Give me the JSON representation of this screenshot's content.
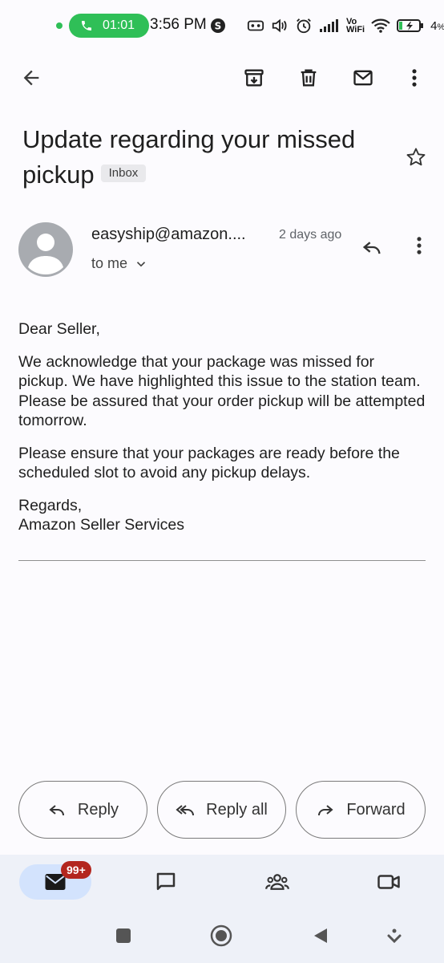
{
  "status_bar": {
    "call_timer": "01:01",
    "time": "3:56 PM",
    "network_top": "Vo",
    "network_bottom": "WiFi",
    "battery_percent": "4",
    "battery_percent_sign": "%"
  },
  "appbar": {
    "icons": [
      "back-arrow-icon",
      "archive-icon",
      "delete-icon",
      "mark-unread-icon",
      "more-vert-icon"
    ]
  },
  "email": {
    "subject": "Update regarding your missed pickup",
    "label_chip": "Inbox",
    "sender": "easyship@amazon....",
    "date": "2 days ago",
    "recipient": "to me",
    "body": {
      "greeting": "Dear Seller,",
      "paragraph1": "We acknowledge that your package was missed for pickup. We have highlighted this issue to the station team. Please be assured that your order pickup will be attempted tomorrow.",
      "paragraph2": "Please ensure that your packages are ready before the scheduled slot to avoid any pickup delays.",
      "signoff": "Regards,",
      "signature": "Amazon Seller Services"
    }
  },
  "actions": {
    "reply": "Reply",
    "reply_all": "Reply all",
    "forward": "Forward"
  },
  "bottom_nav": {
    "mail_badge": "99+",
    "items": [
      "mail-icon",
      "chat-icon",
      "spaces-icon",
      "meet-icon"
    ]
  },
  "colors": {
    "call_green": "#2fbf57",
    "active_nav": "#d3e3fd",
    "badge_red": "#b3261e",
    "nav_bg": "#eef1f8"
  }
}
